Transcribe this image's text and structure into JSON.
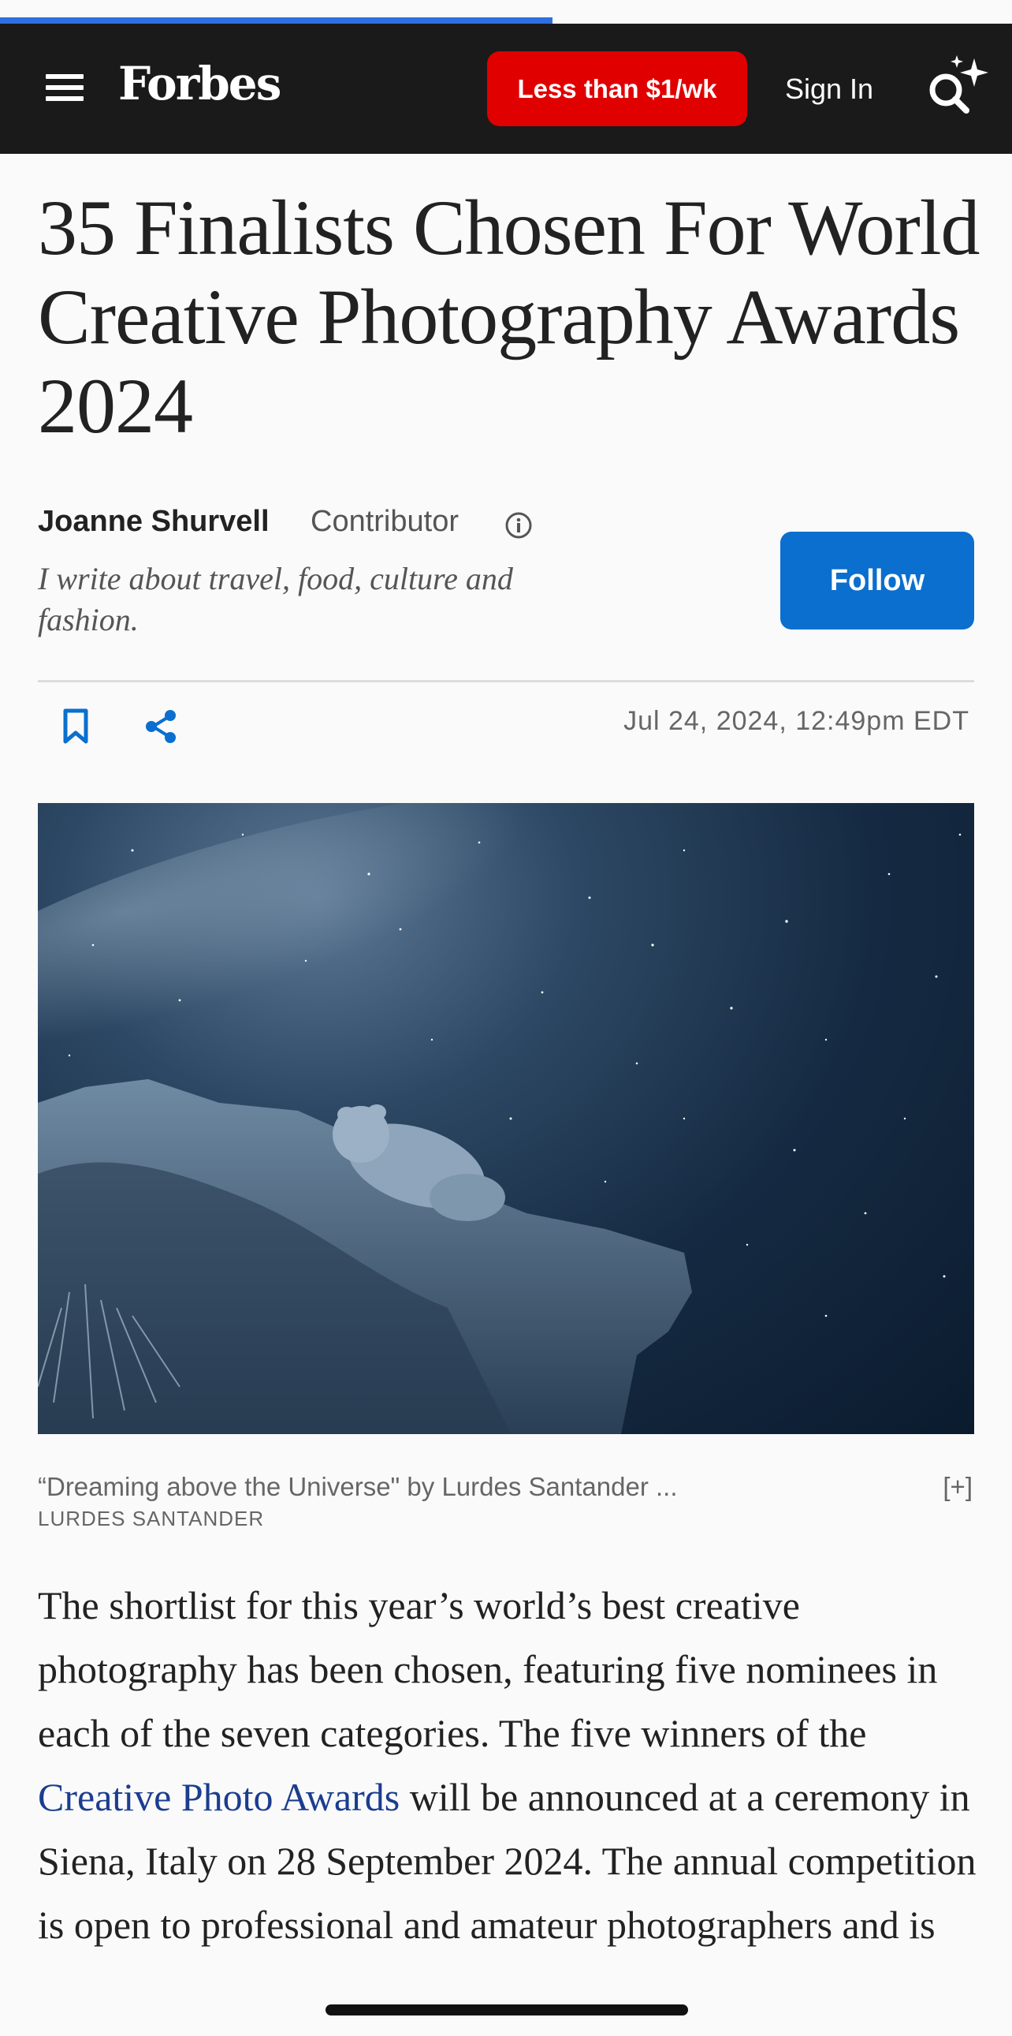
{
  "progress": {
    "fraction": 0.546,
    "color": "#2f6fe0"
  },
  "header": {
    "logo": "Forbes",
    "subscribe_label": "Less than $1/wk",
    "signin_label": "Sign In",
    "icons": {
      "menu": "hamburger-icon",
      "search": "search-sparkle-icon"
    },
    "colors": {
      "bar": "#1a1a1a",
      "subscribe": "#e00000"
    }
  },
  "article": {
    "title": "35 Finalists Chosen For World Creative Photography Awards 2024",
    "author": {
      "name": "Joanne Shurvell",
      "role": "Contributor",
      "bio": "I write about travel, food, culture and fashion."
    },
    "follow_label": "Follow",
    "date": "Jul 24, 2024, 12:49pm EDT",
    "image": {
      "caption": "“Dreaming above the Universe\" by Lurdes Santander ...",
      "expand_label": "[+]",
      "credit": "LURDES SANTANDER"
    },
    "body": {
      "before_link": "The shortlist for this year’s world’s best creative photography has been chosen, featuring five nominees in each of the seven categories. The five winners of the ",
      "link_text": "Creative Photo Awards",
      "after_link": " will be announced at a ceremony in Siena, Italy on 28 September 2024. The annual competition is open to professional and amateur photographers and is"
    }
  }
}
